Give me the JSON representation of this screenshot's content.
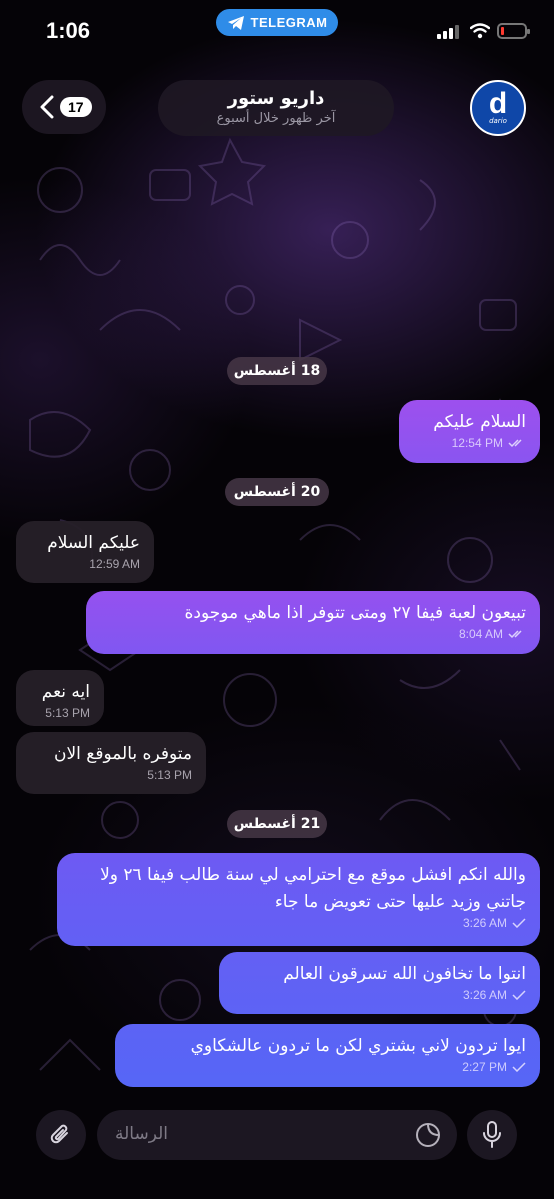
{
  "status_bar": {
    "time": "1:06",
    "app_pill": "TELEGRAM",
    "battery_level": 0.12,
    "battery_color": "#ff3b30"
  },
  "header": {
    "unread_count": "17",
    "contact_name": "داريو ستور",
    "last_seen": "آخر ظهور خلال أسبوع",
    "avatar_letter": "d",
    "avatar_word": "dario",
    "avatar_color": "#0f47a8"
  },
  "messages": [
    {
      "type": "date",
      "text": "18 أغسطس"
    },
    {
      "type": "out",
      "text": "السلام عليكم",
      "time": "12:54 PM",
      "status": "read"
    },
    {
      "type": "date",
      "text": "20 أغسطس"
    },
    {
      "type": "in",
      "text": "عليكم السلام",
      "time": "12:59 AM"
    },
    {
      "type": "out",
      "text": "تبيعون لعبة فيفا ٢٧ ومتى تتوفر اذا ماهي موجودة",
      "time": "8:04 AM",
      "status": "read"
    },
    {
      "type": "in",
      "text": "ايه نعم",
      "time": "5:13 PM"
    },
    {
      "type": "in",
      "text": "متوفره بالموقع الان",
      "time": "5:13 PM"
    },
    {
      "type": "date",
      "text": "21 أغسطس"
    },
    {
      "type": "out",
      "text": "والله انكم افشل موقع مع احترامي لي سنة طالب فيفا ٢٦ ولا جاتني وزيد عليها حتى تعويض ما جاء",
      "time": "3:26 AM",
      "status": "sent"
    },
    {
      "type": "out",
      "text": "انتوا ما تخافون الله تسرقون العالم",
      "time": "3:26 AM",
      "status": "sent"
    },
    {
      "type": "out",
      "text": "ايوا تردون لاني بشتري لكن ما تردون عالشكاوي",
      "time": "2:27 PM",
      "status": "sent"
    }
  ],
  "composer": {
    "placeholder": "الرسالة",
    "attach_icon": "paperclip-icon",
    "sticker_icon": "sticker-icon",
    "mic_icon": "microphone-icon"
  },
  "colors": {
    "outgoing_top": "#a24ff0",
    "outgoing_bottom": "#5560f5",
    "incoming": "#262028",
    "accent": "#2f8ce8"
  }
}
